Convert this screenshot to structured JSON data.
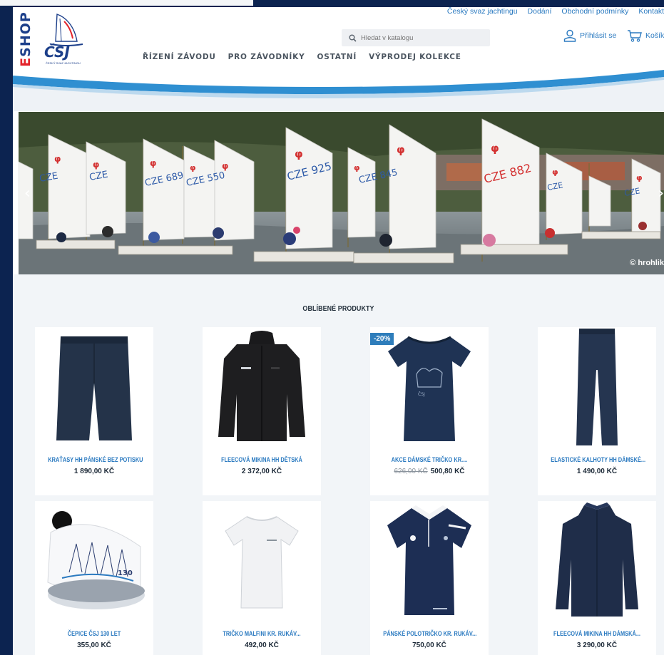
{
  "header": {
    "brand_badge_prefix": "E",
    "brand_badge_rest": "SHOP",
    "logo_text": "ČSJ",
    "logo_caption": "ČESKÝ SVAZ JACHTINGU",
    "top_links": [
      "Český svaz jachtingu",
      "Dodání",
      "Obchodní podmínky",
      "Kontakt"
    ],
    "search_placeholder": "Hledat v katalogu",
    "login_label": "Přihlásit se",
    "cart_label": "Košík",
    "nav": [
      "ŘÍZENÍ ZÁVODU",
      "PRO ZÁVODNÍKY",
      "OSTATNÍ",
      "VÝPRODEJ KOLEKCE"
    ]
  },
  "hero": {
    "credit": "© hrohlik",
    "prev_icon": "chevron-left-icon",
    "next_icon": "chevron-right-icon",
    "sail_numbers": [
      "CZE",
      "CZE",
      "CZE 689",
      "CZE 550",
      "CZE 925",
      "CZE 845",
      "CZE 882",
      "CZE",
      "CZE"
    ]
  },
  "section": {
    "title": "OBLÍBENÉ PRODUKTY"
  },
  "products": [
    {
      "name": "KRAŤASY HH PÁNSKÉ BEZ POTISKU",
      "price": "1 890,00 KČ",
      "old_price": "",
      "badge": "",
      "icon": "shorts-icon"
    },
    {
      "name": "FLEECOVÁ MIKINA HH DĚTSKÁ",
      "price": "2 372,00 KČ",
      "old_price": "",
      "badge": "",
      "icon": "hoodie-icon"
    },
    {
      "name": "AKCE DÁMSKÉ TRIČKO KR....",
      "price": "500,80 KČ",
      "old_price": "626,00 KČ",
      "badge": "-20%",
      "icon": "tshirt-icon"
    },
    {
      "name": "ELASTICKÉ KALHOTY HH DÁMSKÉ...",
      "price": "1 490,00 KČ",
      "old_price": "",
      "badge": "",
      "icon": "pants-icon"
    },
    {
      "name": "ČEPICE ČSJ 130 LET",
      "price": "355,00 KČ",
      "old_price": "",
      "badge": "",
      "icon": "beanie-icon"
    },
    {
      "name": "TRIČKO MALFINI KR. RUKÁV...",
      "price": "492,00 KČ",
      "old_price": "",
      "badge": "",
      "icon": "tshirt-icon"
    },
    {
      "name": "PÁNSKÉ POLOTRIČKO KR. RUKÁV...",
      "price": "750,00 KČ",
      "old_price": "",
      "badge": "",
      "icon": "polo-icon"
    },
    {
      "name": "FLEECOVÁ MIKINA HH DÁMSKÁ...",
      "price": "3 290,00 KČ",
      "old_price": "",
      "badge": "",
      "icon": "jacket-icon"
    }
  ],
  "colors": {
    "frame": "#0c2350",
    "accent_blue": "#2b7ac0",
    "brand_red": "#e3242b",
    "navy_garment": "#1e2d45",
    "badge": "#2e7dbb"
  }
}
